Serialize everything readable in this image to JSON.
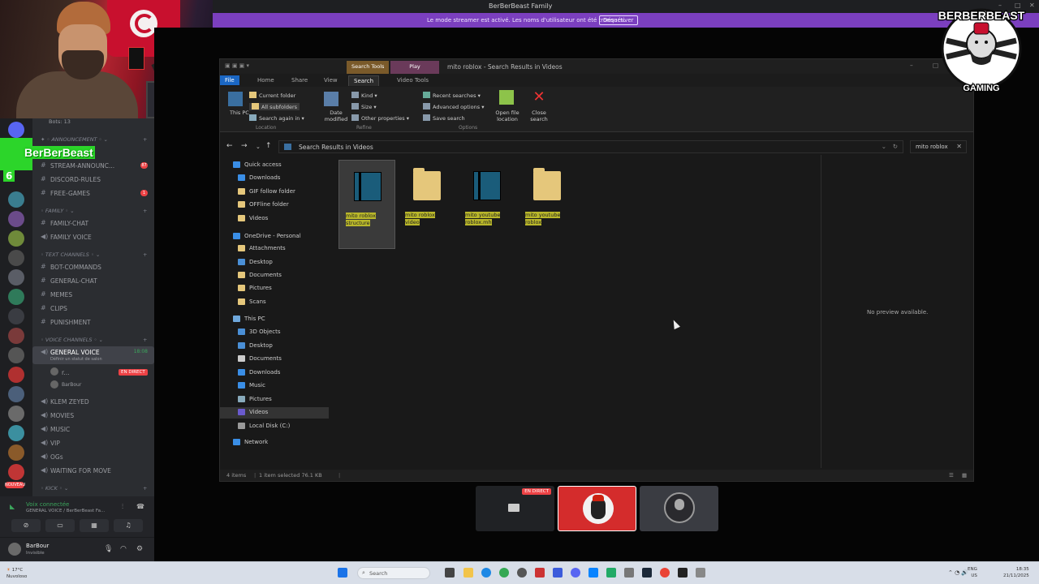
{
  "discord": {
    "window_title": "BerBerBeast Family",
    "streamer_banner": "Le mode streamer est activé. Les noms d'utilisateur ont été tronqués.",
    "banner_button": "Désactiver",
    "bots_label": "Bots: 13",
    "overlay_name": "BerBerBeast",
    "overlay_count": "6",
    "categories": {
      "announcement": "ANNOUNCEMENT",
      "family": "FAMILY",
      "text_channels": "TEXT CHANNELS",
      "voice_channels": "VOICE CHANNELS",
      "kick": "KICK"
    },
    "channels": [
      {
        "name": "STREAM-ANNOUNC...",
        "badge": "87"
      },
      {
        "name": "DISCORD-RULES",
        "badge": ""
      },
      {
        "name": "FREE-GAMES",
        "badge": "1"
      },
      {
        "name": "FAMILY-CHAT",
        "badge": ""
      },
      {
        "name": "FAMILY VOICE",
        "badge": ""
      },
      {
        "name": "BOT-COMMANDS",
        "badge": ""
      },
      {
        "name": "GENERAL-CHAT",
        "badge": ""
      },
      {
        "name": "MEMES",
        "badge": ""
      },
      {
        "name": "CLIPS",
        "badge": ""
      },
      {
        "name": "PUNISHMENT",
        "badge": ""
      }
    ],
    "voice": {
      "active_channel": "GENERAL VOICE",
      "active_time": "18:08",
      "active_sub": "Définir un statut de salon",
      "user1": "r...",
      "user2": "BarBour",
      "live_badge": "EN DIRECT",
      "channels": [
        "KLEM ZEYED",
        "MOVIES",
        "MUSIC",
        "VIP",
        "OGs",
        "WAITING FOR MOVE"
      ]
    },
    "voice_panel": {
      "connected": "Voix connectée",
      "path": "GENERAL VOICE / BerBerBeast Fa..."
    },
    "user_panel": {
      "name": "BarBour",
      "status": "Invisible"
    },
    "new_badge": "NOUVEAU"
  },
  "explorer": {
    "title": "mito roblox - Search Results in Videos",
    "context_tabs": [
      "Search Tools",
      "Play"
    ],
    "ribbon_tabs": [
      "File",
      "Home",
      "Share",
      "View",
      "Search",
      "Video Tools"
    ],
    "ribbon": {
      "this_pc": "This PC",
      "current_folder": "Current folder",
      "all_subfolders": "All subfolders",
      "search_again": "Search again in",
      "date_modified": "Date modified",
      "kind": "Kind",
      "size": "Size",
      "other_properties": "Other properties",
      "recent_searches": "Recent searches",
      "advanced_options": "Advanced options",
      "save_search": "Save search",
      "open_file_location": "Open file location",
      "close_search": "Close search",
      "group_location": "Location",
      "group_refine": "Refine",
      "group_options": "Options"
    },
    "address": "Search Results in Videos",
    "search_query": "mito roblox",
    "nav": [
      {
        "label": "Quick access",
        "type": "star"
      },
      {
        "label": "Downloads",
        "type": "dl"
      },
      {
        "label": "GIF follow folder",
        "type": "folder"
      },
      {
        "label": "OFFline folder",
        "type": "folder"
      },
      {
        "label": "Videos",
        "type": "folder"
      },
      {
        "label": "OneDrive - Personal",
        "type": "cloud"
      },
      {
        "label": "Attachments",
        "type": "folder"
      },
      {
        "label": "Desktop",
        "type": "blue"
      },
      {
        "label": "Documents",
        "type": "folder"
      },
      {
        "label": "Pictures",
        "type": "folder"
      },
      {
        "label": "Scans",
        "type": "folder"
      },
      {
        "label": "This PC",
        "type": "pc"
      },
      {
        "label": "3D Objects",
        "type": "blue"
      },
      {
        "label": "Desktop",
        "type": "blue"
      },
      {
        "label": "Documents",
        "type": "doc"
      },
      {
        "label": "Downloads",
        "type": "dl"
      },
      {
        "label": "Music",
        "type": "music"
      },
      {
        "label": "Pictures",
        "type": "pic"
      },
      {
        "label": "Videos",
        "type": "vid"
      },
      {
        "label": "Local Disk (C:)",
        "type": "disk"
      },
      {
        "label": "Network",
        "type": "net"
      }
    ],
    "files": [
      {
        "pre": "",
        "hl": "mito roblox",
        "post": " structure",
        "kind": "thumb"
      },
      {
        "pre": "",
        "hl": "mito roblox",
        "post": " video",
        "kind": "folder"
      },
      {
        "pre": "",
        "hl": "mito",
        "post": " youtube roblox.mh",
        "kind": "thumb"
      },
      {
        "pre": "",
        "hl": "mito",
        "post": " youtube roblox",
        "kind": "folder"
      }
    ],
    "preview_msg": "No preview available.",
    "status_items": "4 items",
    "status_selected": "1 item selected  76.1 KB"
  },
  "stream_tiles": {
    "live": "EN DIRECT"
  },
  "logo": {
    "top": "BERBERBEAST",
    "bottom": "GAMING"
  },
  "taskbar": {
    "search": "Search",
    "weather_temp": "17°C",
    "weather_desc": "Nuvoloso",
    "lang": "ENG",
    "region": "US",
    "time": "18:35",
    "date": "21/11/2025"
  }
}
